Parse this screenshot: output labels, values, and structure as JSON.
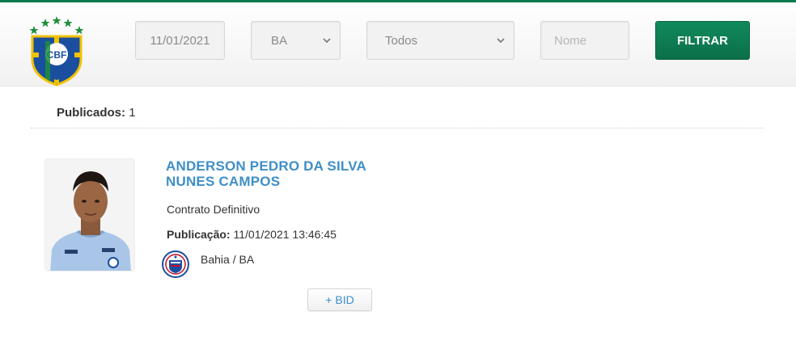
{
  "header": {
    "logo_text": "CBF",
    "date_filter": "11/01/2021",
    "state_select": "BA",
    "type_select": "Todos",
    "name_placeholder": "Nome",
    "filter_button": "FILTRAR"
  },
  "colors": {
    "brand_green": "#0b7a50",
    "link_blue": "#3e8fc8"
  },
  "summary": {
    "published_label": "Publicados:",
    "published_count": "1"
  },
  "athlete": {
    "name_line1": "ANDERSON PEDRO DA SILVA",
    "name_line2": "NUNES CAMPOS",
    "contract": "Contrato Definitivo",
    "publication_label": "Publicação:",
    "publication_value": "11/01/2021 13:46:45",
    "club": "Bahia / BA",
    "bid_button": "+ BID"
  },
  "icons": [
    "cbf-crest-icon",
    "chevron-down-icon",
    "bahia-crest-icon",
    "athlete-photo"
  ]
}
